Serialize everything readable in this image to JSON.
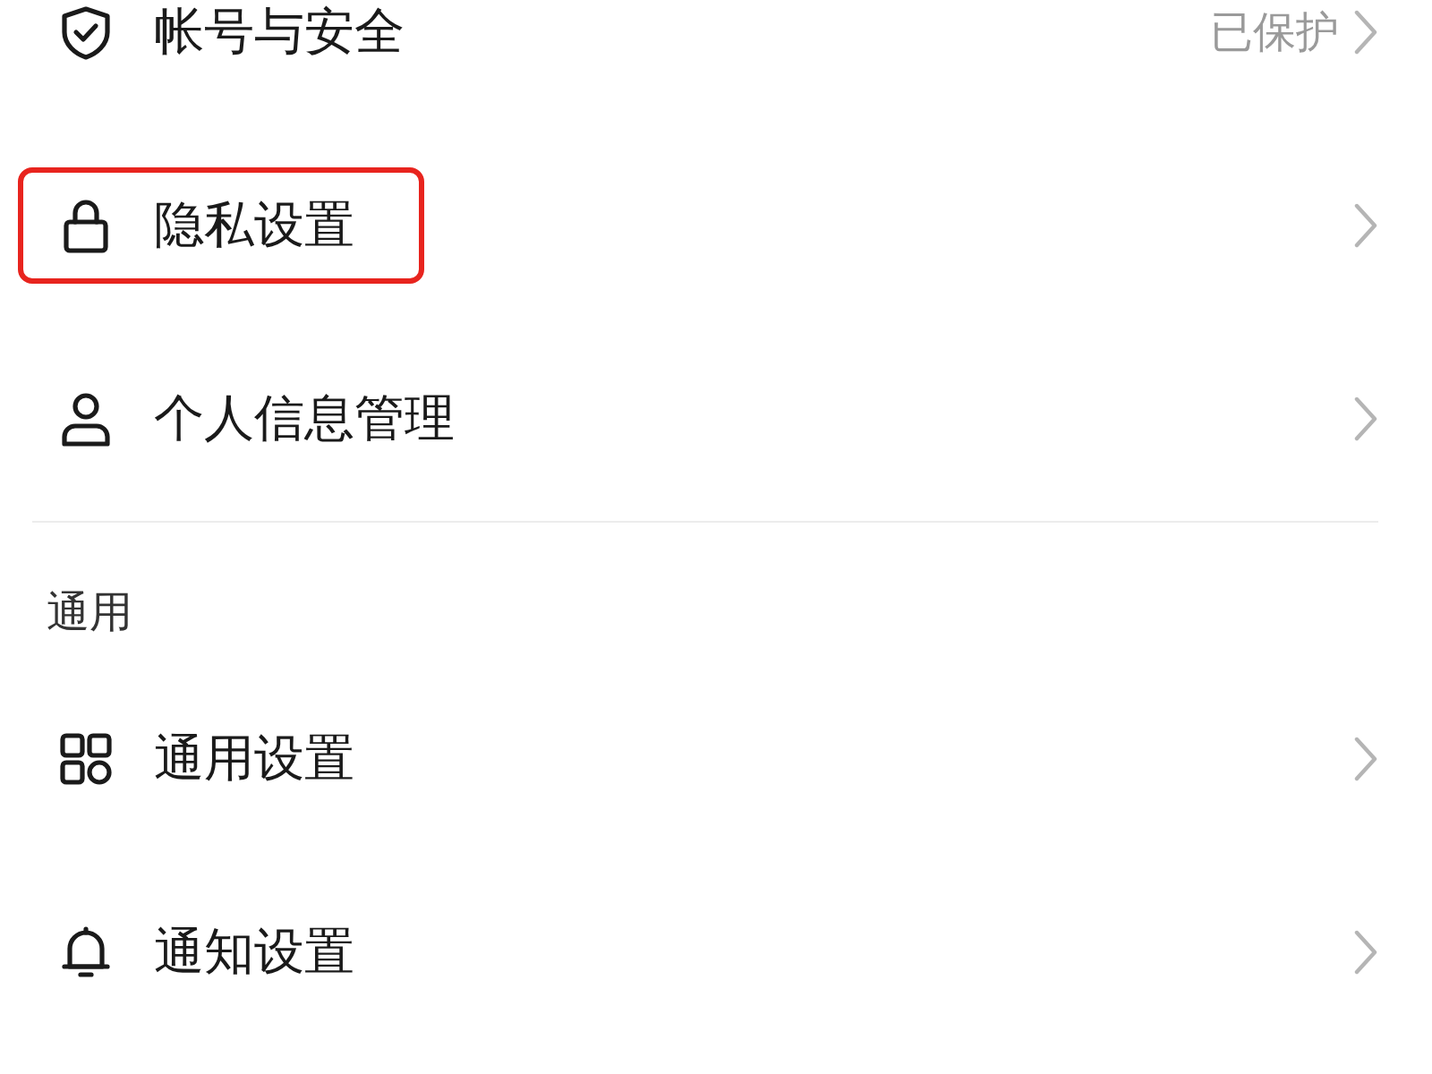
{
  "sections": [
    {
      "items": [
        {
          "kind": "shield",
          "label": "帐号与安全",
          "value": "已保护",
          "highlighted": false
        },
        {
          "kind": "lock",
          "label": "隐私设置",
          "highlighted": true
        },
        {
          "kind": "person",
          "label": "个人信息管理",
          "highlighted": false
        }
      ]
    },
    {
      "title": "通用",
      "items": [
        {
          "kind": "grid",
          "label": "通用设置",
          "highlighted": false
        },
        {
          "kind": "bell",
          "label": "通知设置",
          "highlighted": false
        }
      ]
    }
  ]
}
